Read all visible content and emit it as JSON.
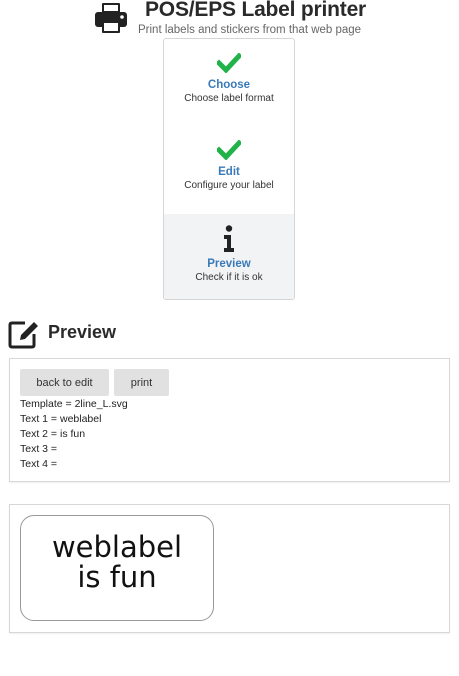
{
  "header": {
    "title": "POS/EPS Label printer",
    "subtitle": "Print labels and stickers from that web page",
    "icon": "printer-icon"
  },
  "steps": [
    {
      "title": "Choose",
      "desc": "Choose label format",
      "icon": "check-icon",
      "state": "done"
    },
    {
      "title": "Edit",
      "desc": "Configure your label",
      "icon": "check-icon",
      "state": "done"
    },
    {
      "title": "Preview",
      "desc": "Check if it is ok",
      "icon": "info-icon",
      "state": "active"
    }
  ],
  "colors": {
    "check": "#21b24a",
    "link": "#3a7ab8",
    "active_bg": "#f2f3f5"
  },
  "preview_section": {
    "title": "Preview",
    "icon": "edit-icon"
  },
  "actions": {
    "back_label": "back to edit",
    "print_label": "print"
  },
  "details": {
    "template": "Template = 2line_L.svg",
    "text1": "Text 1 = weblabel",
    "text2": "Text 2 = is fun",
    "text3": "Text 3 =",
    "text4": "Text 4 ="
  },
  "label": {
    "line1": "weblabel",
    "line2": "is fun"
  }
}
